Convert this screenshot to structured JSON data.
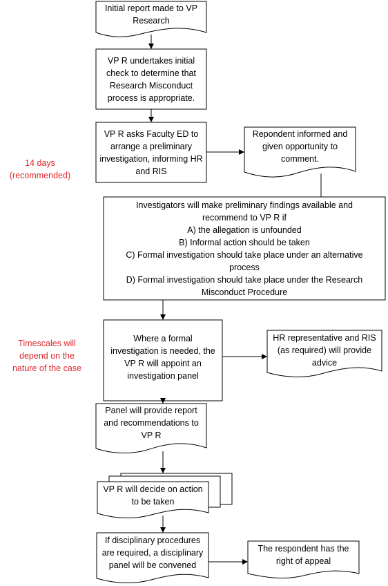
{
  "steps": {
    "initial_report": [
      "Initial report made to VP",
      "Research"
    ],
    "initial_check": [
      "VP R undertakes initial",
      "check to determine that",
      "Research Misconduct",
      "process is appropriate."
    ],
    "preliminary": [
      "VP R asks Faculty ED to",
      "arrange a preliminary",
      "investigation, informing HR",
      "and RIS"
    ],
    "respondent_informed": [
      "Repondent informed and",
      "given opportunity to",
      "comment."
    ],
    "findings": [
      "Investigators will make preliminary findings available and",
      "recommend to VP R if",
      "A) the allegation is unfounded",
      "B) Informal action should be taken",
      "C) Formal investigation should take place under an alternative",
      "process",
      "D) Formal investigation should take place under the Research",
      "Misconduct Procedure"
    ],
    "panel_appointed": [
      "Where a formal",
      "investigation is needed, the",
      "VP R will appoint an",
      "investigation panel"
    ],
    "hr_advice": [
      "HR representative and RIS",
      "(as required) will provide",
      "advice"
    ],
    "panel_report": [
      "Panel will provide report",
      "and recommendations to",
      "VP R"
    ],
    "decide_action": [
      "VP R will decide on action",
      "to be taken"
    ],
    "disciplinary": [
      "If disciplinary procedures",
      "are required, a disciplinary",
      "panel will be convened"
    ],
    "appeal": [
      "The respondent has the",
      "right of appeal"
    ]
  },
  "annotations": {
    "fourteen_days": [
      "14 days",
      "(recommended)"
    ],
    "timescales": [
      "Timescales will",
      "depend on the",
      "nature of the case"
    ]
  },
  "colors": {
    "annotation": "#e0262b",
    "stroke": "#000000"
  }
}
